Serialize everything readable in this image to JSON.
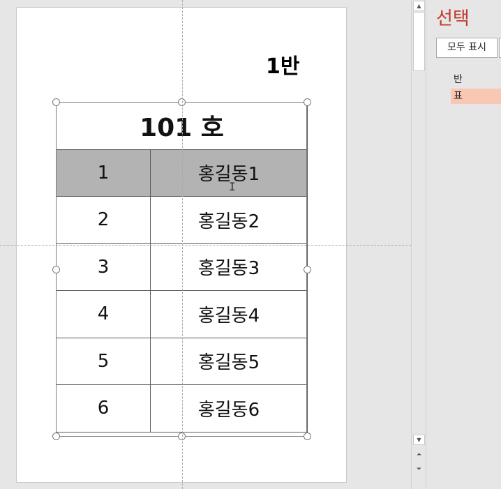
{
  "slide": {
    "class_label": "1반",
    "table": {
      "title": "101 호",
      "rows": [
        {
          "num": "1",
          "name": "홍길동1",
          "selected": true
        },
        {
          "num": "2",
          "name": "홍길동2"
        },
        {
          "num": "3",
          "name": "홍길동3"
        },
        {
          "num": "4",
          "name": "홍길동4"
        },
        {
          "num": "5",
          "name": "홍길동5"
        },
        {
          "num": "6",
          "name": "홍길동6"
        }
      ]
    }
  },
  "selection_pane": {
    "title": "선택",
    "show_all_label": "모두 표시",
    "items": [
      {
        "label": "반",
        "active": false
      },
      {
        "label": "표",
        "active": true
      }
    ]
  },
  "icons": {
    "scroll_up": "triangle-up-icon",
    "scroll_down": "triangle-down-icon",
    "prev_slide": "double-chevron-up-icon",
    "next_slide": "double-chevron-down-icon",
    "text_cursor": "i-beam-cursor-icon"
  },
  "colors": {
    "pane_title": "#c0392b",
    "selected_row": "#b3b3b3",
    "active_item": "#f8c8b3"
  }
}
